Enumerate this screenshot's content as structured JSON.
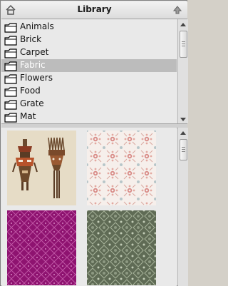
{
  "library": {
    "title": "Library",
    "home_icon": "home-icon",
    "up_icon": "up-arrow-icon"
  },
  "folders": [
    {
      "label": "Animals"
    },
    {
      "label": "Brick"
    },
    {
      "label": "Carpet"
    },
    {
      "label": "Fabric",
      "selected": true
    },
    {
      "label": "Flowers"
    },
    {
      "label": "Food"
    },
    {
      "label": "Grate"
    },
    {
      "label": "Mat"
    }
  ],
  "thumbnails": [
    {
      "name": "African Masks"
    },
    {
      "name": "Pink Floral Tile"
    },
    {
      "name": "Magenta Lattice"
    },
    {
      "name": "Green Damask"
    }
  ],
  "colors": {
    "selection": "#bcbcbc",
    "magenta": "#8e1370",
    "sage": "#5f6b55"
  }
}
